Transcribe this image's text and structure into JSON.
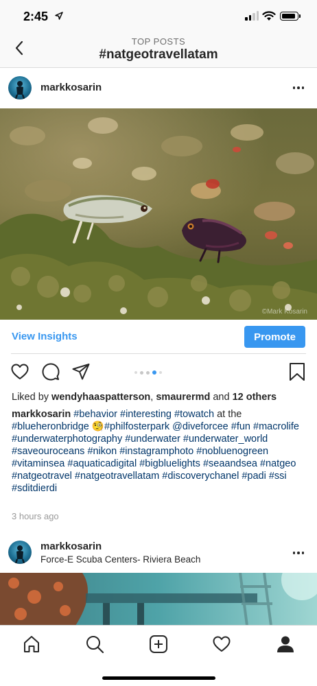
{
  "status_bar": {
    "time": "2:45"
  },
  "header": {
    "subtitle": "TOP POSTS",
    "title": "#natgeotravellatam"
  },
  "post": {
    "username": "markkosarin",
    "photo_credit": "©Mark Kosarin",
    "insights_label": "View Insights",
    "promote_label": "Promote",
    "carousel": {
      "count": 5,
      "active_index": 3
    },
    "likes": {
      "prefix": "Liked by ",
      "user1": "wendyhaaspatterson",
      "sep": ", ",
      "user2": "smaurermd",
      "and": " and ",
      "others": "12 others"
    },
    "caption": {
      "user": "markkosarin",
      "t1": "#behavior",
      "t2": "#interesting",
      "t3": "#towatch",
      "at_the": " at the ",
      "t4": "#blueheronbridge",
      "emoji": "🧐",
      "t5": "#philfosterpark",
      "t6": "@diveforcee",
      "t7": "#fun",
      "t8": "#macrolife",
      "t9": "#underwaterphotography",
      "t10": "#underwater",
      "t11": "#underwater_world",
      "t12": "#saveouroceans",
      "t13": "#nikon",
      "t14": "#instagramphoto",
      "t15": "#nobluenogreen",
      "t16": "#vitaminsea",
      "t17": "#aquaticadigital",
      "t18": "#bigbluelights",
      "t19": "#seaandsea",
      "t20": "#natgeo",
      "t21": "#natgeotravel",
      "t22": "#natgeotravellatam",
      "t23": "#discoverychanel",
      "t24": "#padi",
      "t25": "#ssi",
      "t26": "#sditdierdi"
    },
    "timestamp": "3 hours ago"
  },
  "post2": {
    "username": "markkosarin",
    "location": "Force-E Scuba Centers- Riviera Beach"
  },
  "icons": {
    "back": "chevron-left-icon",
    "more": "more-horizontal-icon",
    "like": "heart-icon",
    "comment": "comment-icon",
    "share": "send-icon",
    "save": "bookmark-icon",
    "nav": [
      "home-icon",
      "search-icon",
      "add-icon",
      "activity-heart-icon",
      "profile-icon"
    ]
  },
  "colors": {
    "accent": "#3897f0",
    "hashtag": "#003569",
    "muted": "#999999"
  }
}
